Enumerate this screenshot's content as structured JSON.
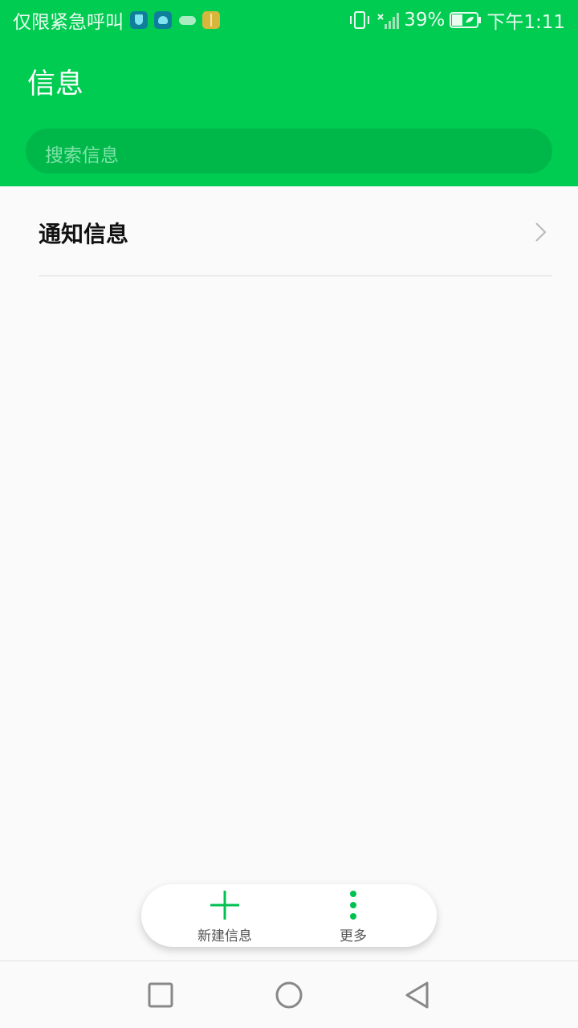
{
  "status_bar": {
    "carrier_text": "仅限紧急呼叫",
    "battery": "39%",
    "time": "下午1:11",
    "icons": [
      "shield-app-icon",
      "heart-app-icon",
      "cloud-icon",
      "gift-app-icon",
      "vibrate-icon",
      "no-signal-icon",
      "battery-icon"
    ]
  },
  "header": {
    "title": "信息",
    "search_placeholder": "搜索信息"
  },
  "list": {
    "items": [
      {
        "label": "通知信息"
      }
    ]
  },
  "actions": {
    "new_label": "新建信息",
    "more_label": "更多"
  },
  "nav": {
    "icons": [
      "recents-icon",
      "home-icon",
      "back-icon"
    ]
  },
  "colors": {
    "accent": "#00cc52",
    "search_bg": "#00b84a"
  }
}
